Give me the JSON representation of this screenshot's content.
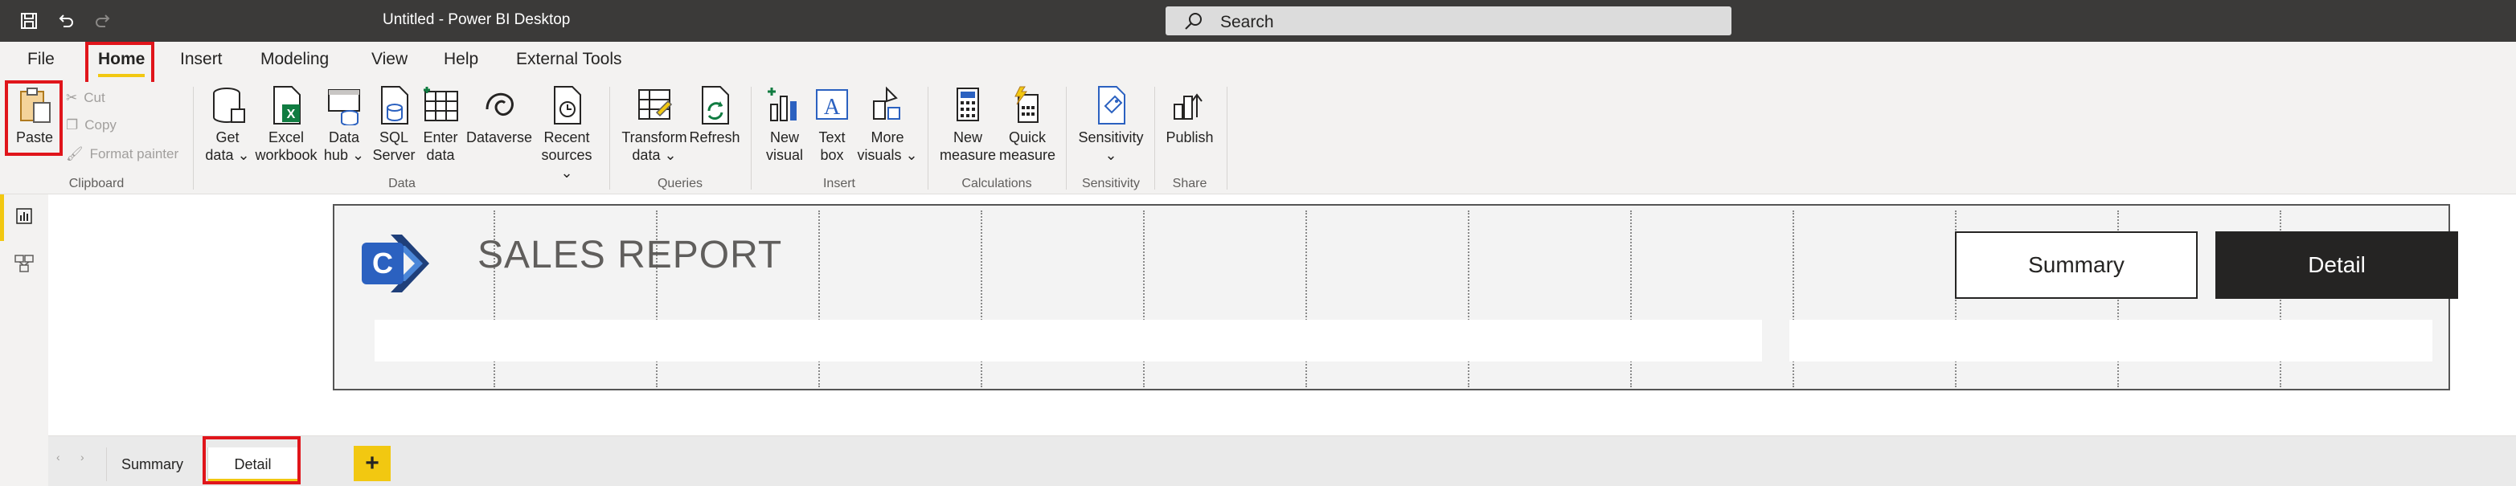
{
  "titlebar": {
    "title": "Untitled - Power BI Desktop",
    "search_placeholder": "Search",
    "icons": [
      "save-icon",
      "undo-icon",
      "redo-icon"
    ]
  },
  "ribbon_tabs": [
    "File",
    "Home",
    "Insert",
    "Modeling",
    "View",
    "Help",
    "External Tools"
  ],
  "active_tab": "Home",
  "ribbon": {
    "clipboard": {
      "label": "Clipboard",
      "paste": "Paste",
      "cut": "Cut",
      "copy": "Copy",
      "format_painter": "Format painter"
    },
    "data": {
      "label": "Data",
      "get_data": [
        "Get",
        "data"
      ],
      "excel": [
        "Excel",
        "workbook"
      ],
      "data_hub": [
        "Data",
        "hub"
      ],
      "sql": [
        "SQL",
        "Server"
      ],
      "enter_data": [
        "Enter",
        "data"
      ],
      "dataverse": "Dataverse",
      "recent": [
        "Recent",
        "sources"
      ]
    },
    "queries": {
      "label": "Queries",
      "transform": [
        "Transform",
        "data"
      ],
      "refresh": "Refresh"
    },
    "insert": {
      "label": "Insert",
      "new_visual": [
        "New",
        "visual"
      ],
      "text_box": [
        "Text",
        "box"
      ],
      "more_visuals": [
        "More",
        "visuals"
      ]
    },
    "calculations": {
      "label": "Calculations",
      "new_measure": [
        "New",
        "measure"
      ],
      "quick_measure": [
        "Quick",
        "measure"
      ]
    },
    "sensitivity": {
      "label": "Sensitivity",
      "button": "Sensitivity"
    },
    "share": {
      "label": "Share",
      "publish": "Publish"
    }
  },
  "report": {
    "title": "SALES REPORT",
    "logo_letter": "C",
    "nav_summary": "Summary",
    "nav_detail": "Detail"
  },
  "page_tabs": [
    "Summary",
    "Detail"
  ],
  "active_page": "Detail",
  "add_page": "+",
  "colors": {
    "accent": "#f2c811",
    "highlight": "#e0151b",
    "titlebar": "#3b3a39",
    "logo": "#2b61c0"
  }
}
